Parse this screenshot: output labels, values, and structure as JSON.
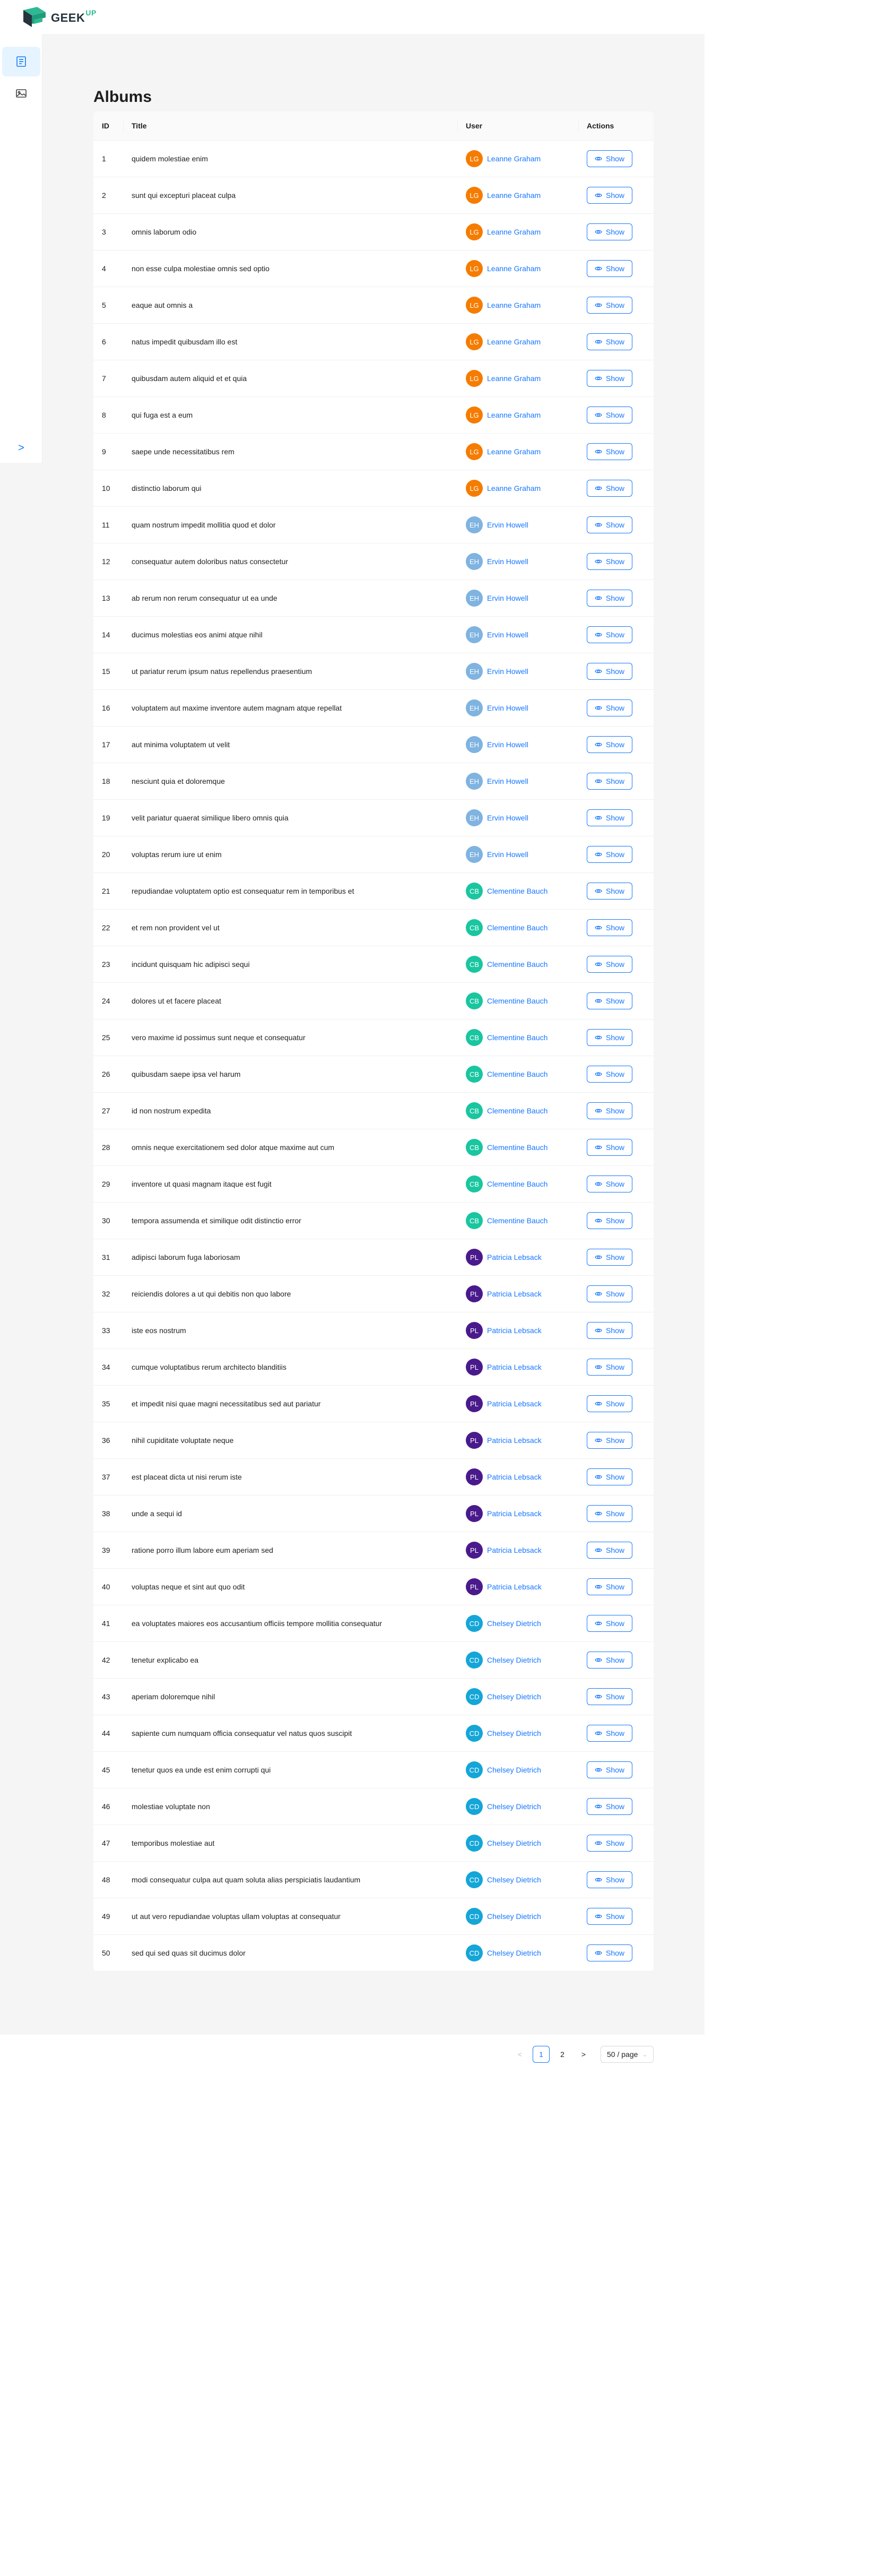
{
  "app": {
    "logo_text": "GEEK",
    "logo_sup": "UP",
    "colors": {
      "primary": "#1677ff",
      "logo_green": "#2fb893",
      "logo_dark": "#24333d"
    }
  },
  "sidebar": {
    "items": [
      {
        "icon": "posts-list-icon",
        "active": true
      },
      {
        "icon": "albums-image-icon",
        "active": false
      }
    ],
    "collapse_icon": ">"
  },
  "page": {
    "title": "Albums"
  },
  "table": {
    "columns": [
      "ID",
      "Title",
      "User",
      "Actions"
    ],
    "action_label": "Show",
    "rows": [
      {
        "id": "1",
        "title": "quidem molestiae enim",
        "initials": "LG",
        "user": "Leanne Graham",
        "color": "#f57c00"
      },
      {
        "id": "2",
        "title": "sunt qui excepturi placeat culpa",
        "initials": "LG",
        "user": "Leanne Graham",
        "color": "#f57c00"
      },
      {
        "id": "3",
        "title": "omnis laborum odio",
        "initials": "LG",
        "user": "Leanne Graham",
        "color": "#f57c00"
      },
      {
        "id": "4",
        "title": "non esse culpa molestiae omnis sed optio",
        "initials": "LG",
        "user": "Leanne Graham",
        "color": "#f57c00"
      },
      {
        "id": "5",
        "title": "eaque aut omnis a",
        "initials": "LG",
        "user": "Leanne Graham",
        "color": "#f57c00"
      },
      {
        "id": "6",
        "title": "natus impedit quibusdam illo est",
        "initials": "LG",
        "user": "Leanne Graham",
        "color": "#f57c00"
      },
      {
        "id": "7",
        "title": "quibusdam autem aliquid et et quia",
        "initials": "LG",
        "user": "Leanne Graham",
        "color": "#f57c00"
      },
      {
        "id": "8",
        "title": "qui fuga est a eum",
        "initials": "LG",
        "user": "Leanne Graham",
        "color": "#f57c00"
      },
      {
        "id": "9",
        "title": "saepe unde necessitatibus rem",
        "initials": "LG",
        "user": "Leanne Graham",
        "color": "#f57c00"
      },
      {
        "id": "10",
        "title": "distinctio laborum qui",
        "initials": "LG",
        "user": "Leanne Graham",
        "color": "#f57c00"
      },
      {
        "id": "11",
        "title": "quam nostrum impedit mollitia quod et dolor",
        "initials": "EH",
        "user": "Ervin Howell",
        "color": "#7fb3e0"
      },
      {
        "id": "12",
        "title": "consequatur autem doloribus natus consectetur",
        "initials": "EH",
        "user": "Ervin Howell",
        "color": "#7fb3e0"
      },
      {
        "id": "13",
        "title": "ab rerum non rerum consequatur ut ea unde",
        "initials": "EH",
        "user": "Ervin Howell",
        "color": "#7fb3e0"
      },
      {
        "id": "14",
        "title": "ducimus molestias eos animi atque nihil",
        "initials": "EH",
        "user": "Ervin Howell",
        "color": "#7fb3e0"
      },
      {
        "id": "15",
        "title": "ut pariatur rerum ipsum natus repellendus praesentium",
        "initials": "EH",
        "user": "Ervin Howell",
        "color": "#7fb3e0"
      },
      {
        "id": "16",
        "title": "voluptatem aut maxime inventore autem magnam atque repellat",
        "initials": "EH",
        "user": "Ervin Howell",
        "color": "#7fb3e0"
      },
      {
        "id": "17",
        "title": "aut minima voluptatem ut velit",
        "initials": "EH",
        "user": "Ervin Howell",
        "color": "#7fb3e0"
      },
      {
        "id": "18",
        "title": "nesciunt quia et doloremque",
        "initials": "EH",
        "user": "Ervin Howell",
        "color": "#7fb3e0"
      },
      {
        "id": "19",
        "title": "velit pariatur quaerat similique libero omnis quia",
        "initials": "EH",
        "user": "Ervin Howell",
        "color": "#7fb3e0"
      },
      {
        "id": "20",
        "title": "voluptas rerum iure ut enim",
        "initials": "EH",
        "user": "Ervin Howell",
        "color": "#7fb3e0"
      },
      {
        "id": "21",
        "title": "repudiandae voluptatem optio est consequatur rem in temporibus et",
        "initials": "CB",
        "user": "Clementine Bauch",
        "color": "#19c6a0"
      },
      {
        "id": "22",
        "title": "et rem non provident vel ut",
        "initials": "CB",
        "user": "Clementine Bauch",
        "color": "#19c6a0"
      },
      {
        "id": "23",
        "title": "incidunt quisquam hic adipisci sequi",
        "initials": "CB",
        "user": "Clementine Bauch",
        "color": "#19c6a0"
      },
      {
        "id": "24",
        "title": "dolores ut et facere placeat",
        "initials": "CB",
        "user": "Clementine Bauch",
        "color": "#19c6a0"
      },
      {
        "id": "25",
        "title": "vero maxime id possimus sunt neque et consequatur",
        "initials": "CB",
        "user": "Clementine Bauch",
        "color": "#19c6a0"
      },
      {
        "id": "26",
        "title": "quibusdam saepe ipsa vel harum",
        "initials": "CB",
        "user": "Clementine Bauch",
        "color": "#19c6a0"
      },
      {
        "id": "27",
        "title": "id non nostrum expedita",
        "initials": "CB",
        "user": "Clementine Bauch",
        "color": "#19c6a0"
      },
      {
        "id": "28",
        "title": "omnis neque exercitationem sed dolor atque maxime aut cum",
        "initials": "CB",
        "user": "Clementine Bauch",
        "color": "#19c6a0"
      },
      {
        "id": "29",
        "title": "inventore ut quasi magnam itaque est fugit",
        "initials": "CB",
        "user": "Clementine Bauch",
        "color": "#19c6a0"
      },
      {
        "id": "30",
        "title": "tempora assumenda et similique odit distinctio error",
        "initials": "CB",
        "user": "Clementine Bauch",
        "color": "#19c6a0"
      },
      {
        "id": "31",
        "title": "adipisci laborum fuga laboriosam",
        "initials": "PL",
        "user": "Patricia Lebsack",
        "color": "#4a1a8c"
      },
      {
        "id": "32",
        "title": "reiciendis dolores a ut qui debitis non quo labore",
        "initials": "PL",
        "user": "Patricia Lebsack",
        "color": "#4a1a8c"
      },
      {
        "id": "33",
        "title": "iste eos nostrum",
        "initials": "PL",
        "user": "Patricia Lebsack",
        "color": "#4a1a8c"
      },
      {
        "id": "34",
        "title": "cumque voluptatibus rerum architecto blanditiis",
        "initials": "PL",
        "user": "Patricia Lebsack",
        "color": "#4a1a8c"
      },
      {
        "id": "35",
        "title": "et impedit nisi quae magni necessitatibus sed aut pariatur",
        "initials": "PL",
        "user": "Patricia Lebsack",
        "color": "#4a1a8c"
      },
      {
        "id": "36",
        "title": "nihil cupiditate voluptate neque",
        "initials": "PL",
        "user": "Patricia Lebsack",
        "color": "#4a1a8c"
      },
      {
        "id": "37",
        "title": "est placeat dicta ut nisi rerum iste",
        "initials": "PL",
        "user": "Patricia Lebsack",
        "color": "#4a1a8c"
      },
      {
        "id": "38",
        "title": "unde a sequi id",
        "initials": "PL",
        "user": "Patricia Lebsack",
        "color": "#4a1a8c"
      },
      {
        "id": "39",
        "title": "ratione porro illum labore eum aperiam sed",
        "initials": "PL",
        "user": "Patricia Lebsack",
        "color": "#4a1a8c"
      },
      {
        "id": "40",
        "title": "voluptas neque et sint aut quo odit",
        "initials": "PL",
        "user": "Patricia Lebsack",
        "color": "#4a1a8c"
      },
      {
        "id": "41",
        "title": "ea voluptates maiores eos accusantium officiis tempore mollitia consequatur",
        "initials": "CD",
        "user": "Chelsey Dietrich",
        "color": "#15a6d8"
      },
      {
        "id": "42",
        "title": "tenetur explicabo ea",
        "initials": "CD",
        "user": "Chelsey Dietrich",
        "color": "#15a6d8"
      },
      {
        "id": "43",
        "title": "aperiam doloremque nihil",
        "initials": "CD",
        "user": "Chelsey Dietrich",
        "color": "#15a6d8"
      },
      {
        "id": "44",
        "title": "sapiente cum numquam officia consequatur vel natus quos suscipit",
        "initials": "CD",
        "user": "Chelsey Dietrich",
        "color": "#15a6d8"
      },
      {
        "id": "45",
        "title": "tenetur quos ea unde est enim corrupti qui",
        "initials": "CD",
        "user": "Chelsey Dietrich",
        "color": "#15a6d8"
      },
      {
        "id": "46",
        "title": "molestiae voluptate non",
        "initials": "CD",
        "user": "Chelsey Dietrich",
        "color": "#15a6d8"
      },
      {
        "id": "47",
        "title": "temporibus molestiae aut",
        "initials": "CD",
        "user": "Chelsey Dietrich",
        "color": "#15a6d8"
      },
      {
        "id": "48",
        "title": "modi consequatur culpa aut quam soluta alias perspiciatis laudantium",
        "initials": "CD",
        "user": "Chelsey Dietrich",
        "color": "#15a6d8"
      },
      {
        "id": "49",
        "title": "ut aut vero repudiandae voluptas ullam voluptas at consequatur",
        "initials": "CD",
        "user": "Chelsey Dietrich",
        "color": "#15a6d8"
      },
      {
        "id": "50",
        "title": "sed qui sed quas sit ducimus dolor",
        "initials": "CD",
        "user": "Chelsey Dietrich",
        "color": "#15a6d8"
      }
    ]
  },
  "pagination": {
    "prev": "<",
    "pages": [
      "1",
      "2"
    ],
    "current": "1",
    "next": ">",
    "page_size": "50 / page"
  }
}
